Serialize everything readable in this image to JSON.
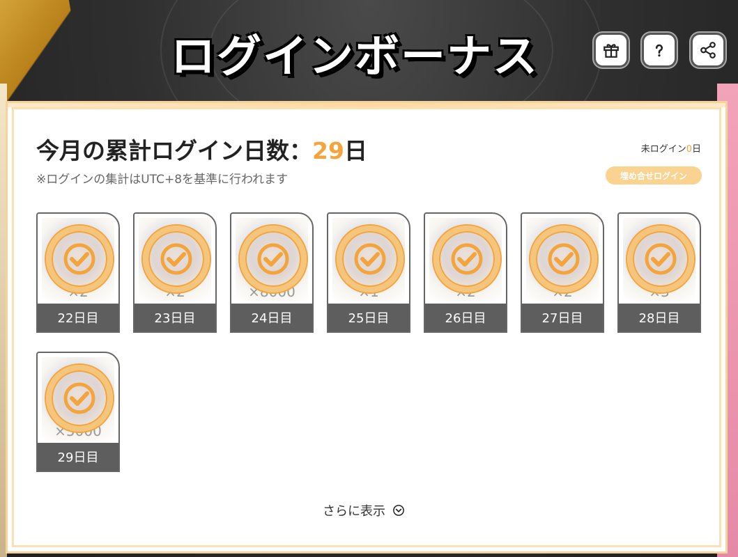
{
  "header": {
    "title": "ログインボーナス",
    "buttons": [
      {
        "name": "gift-button",
        "icon": "gift-icon"
      },
      {
        "name": "help-button",
        "icon": "question-icon"
      },
      {
        "name": "share-button",
        "icon": "share-icon"
      }
    ]
  },
  "summary": {
    "cumulative_label": "今月の累計ログイン日数：",
    "cumulative_days": "29",
    "cumulative_unit": "日",
    "note": "※ログインの集計はUTC+8を基準に行われます",
    "missed_label": "未ログイン",
    "missed_days": "0",
    "missed_unit": "日",
    "makeup_button": "埋め合せログイン"
  },
  "rewards": [
    {
      "day": "22日目",
      "qty": "×2",
      "claimed": true
    },
    {
      "day": "23日目",
      "qty": "×2",
      "claimed": true
    },
    {
      "day": "24日目",
      "qty": "×8000",
      "claimed": true
    },
    {
      "day": "25日目",
      "qty": "×1",
      "claimed": true
    },
    {
      "day": "26日目",
      "qty": "×2",
      "claimed": true
    },
    {
      "day": "27日目",
      "qty": "×2",
      "claimed": true
    },
    {
      "day": "28日目",
      "qty": "×3",
      "claimed": true
    },
    {
      "day": "29日目",
      "qty": "×5000",
      "claimed": true
    }
  ],
  "footer": {
    "show_more": "さらに表示",
    "icon": "chevron-down-circle-icon"
  },
  "colors": {
    "accent": "#f5a33c",
    "day_bar": "#5e5e5e",
    "makeup_button": "#fbd391"
  }
}
